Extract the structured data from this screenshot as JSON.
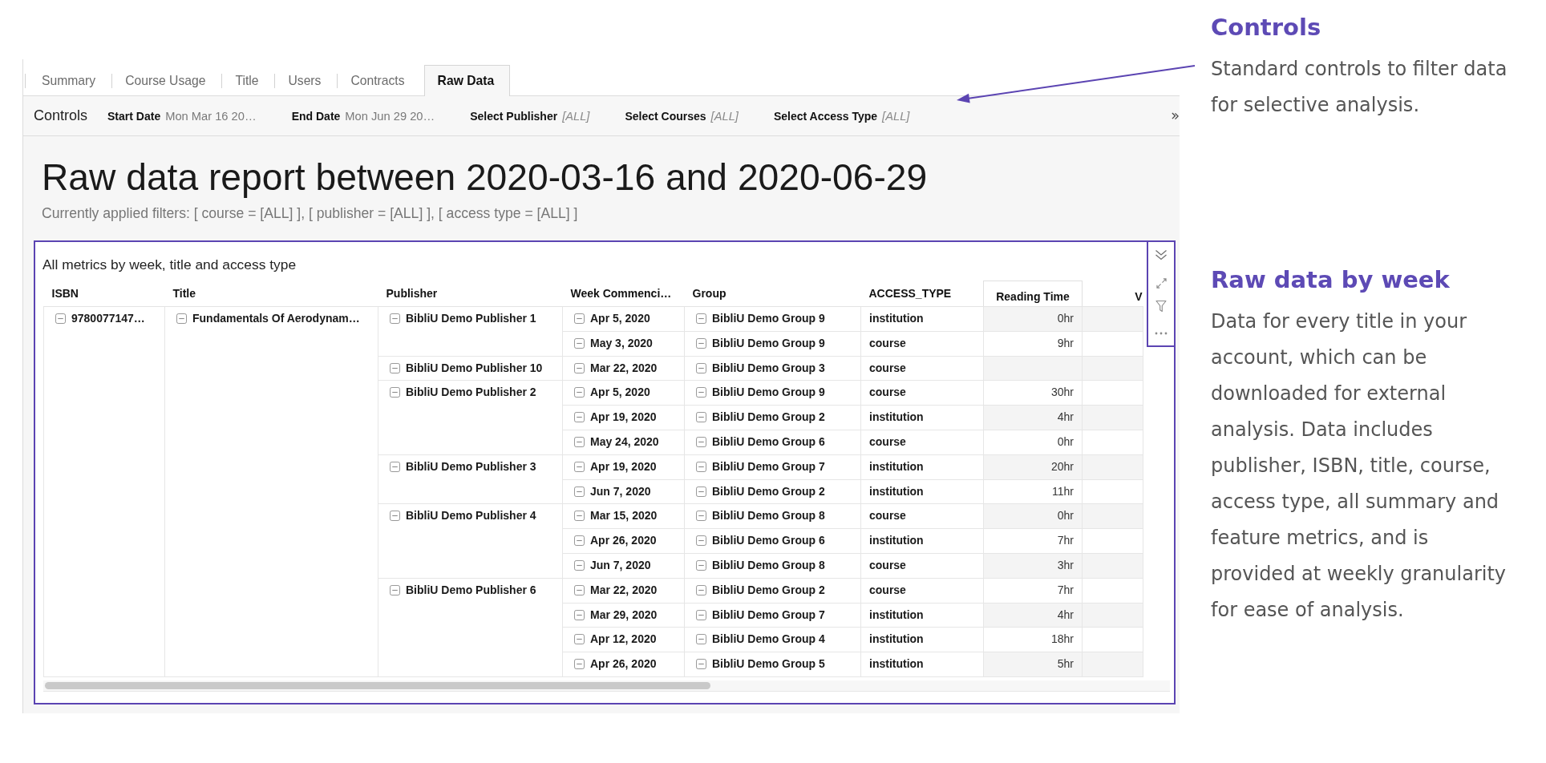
{
  "tabs": [
    {
      "label": "Summary",
      "selected": false
    },
    {
      "label": "Course Usage",
      "selected": false
    },
    {
      "label": "Title",
      "selected": false
    },
    {
      "label": "Users",
      "selected": false
    },
    {
      "label": "Contracts",
      "selected": false
    },
    {
      "label": "Raw Data",
      "selected": true
    }
  ],
  "controls": {
    "title": "Controls",
    "filters": [
      {
        "label": "Start Date",
        "value": "Mon Mar 16 20…",
        "kind": "date"
      },
      {
        "label": "End Date",
        "value": "Mon Jun 29 20…",
        "kind": "date"
      },
      {
        "label": "Select Publisher",
        "value": "[ALL]",
        "kind": "select"
      },
      {
        "label": "Select Courses",
        "value": "[ALL]",
        "kind": "select"
      },
      {
        "label": "Select Access Type",
        "value": "[ALL]",
        "kind": "select"
      }
    ]
  },
  "report": {
    "title": "Raw data report between 2020-03-16 and 2020-06-29",
    "applied_filters": "Currently applied filters: [ course = [ALL] ], [ publisher = [ALL] ], [ access type = [ALL] ]"
  },
  "visual": {
    "title": "All metrics by week, title and access type",
    "table": {
      "columns": [
        "ISBN",
        "Title",
        "Publisher",
        "Week Commenci…",
        "Group",
        "ACCESS_TYPE",
        "Reading Time",
        "V"
      ],
      "isbn": {
        "text": "9780077147…",
        "expanded": true
      },
      "title": {
        "text": "Fundamentals Of Aerodynam…",
        "expanded": true
      },
      "publishers": [
        {
          "name": "BibliU Demo Publisher 1",
          "expanded": true,
          "rows": [
            {
              "week": "Apr 5, 2020",
              "week_expanded": true,
              "group": "BibliU Demo Group 9",
              "group_expanded": true,
              "access_type": "institution",
              "reading_time": "0hr"
            },
            {
              "week": "May 3, 2020",
              "week_expanded": true,
              "group": "BibliU Demo Group 9",
              "group_expanded": true,
              "access_type": "course",
              "reading_time": "9hr"
            }
          ]
        },
        {
          "name": "BibliU Demo Publisher 10",
          "expanded": true,
          "rows": [
            {
              "week": "Mar 22, 2020",
              "week_expanded": true,
              "group": "BibliU Demo Group 3",
              "group_expanded": true,
              "access_type": "course"
            }
          ]
        },
        {
          "name": "BibliU Demo Publisher 2",
          "expanded": true,
          "rows": [
            {
              "week": "Apr 5, 2020",
              "week_expanded": true,
              "group": "BibliU Demo Group 9",
              "group_expanded": true,
              "access_type": "course",
              "reading_time": "30hr"
            },
            {
              "week": "Apr 19, 2020",
              "week_expanded": true,
              "group": "BibliU Demo Group 2",
              "group_expanded": true,
              "access_type": "institution",
              "reading_time": "4hr"
            },
            {
              "week": "May 24, 2020",
              "week_expanded": true,
              "group": "BibliU Demo Group 6",
              "group_expanded": true,
              "access_type": "course",
              "reading_time": "0hr"
            }
          ]
        },
        {
          "name": "BibliU Demo Publisher 3",
          "expanded": true,
          "rows": [
            {
              "week": "Apr 19, 2020",
              "week_expanded": true,
              "group": "BibliU Demo Group 7",
              "group_expanded": true,
              "access_type": "institution",
              "reading_time": "20hr"
            },
            {
              "week": "Jun 7, 2020",
              "week_expanded": true,
              "group": "BibliU Demo Group 2",
              "group_expanded": true,
              "access_type": "institution",
              "reading_time": "11hr"
            }
          ]
        },
        {
          "name": "BibliU Demo Publisher 4",
          "expanded": true,
          "rows": [
            {
              "week": "Mar 15, 2020",
              "week_expanded": true,
              "group": "BibliU Demo Group 8",
              "group_expanded": true,
              "access_type": "course",
              "reading_time": "0hr"
            },
            {
              "week": "Apr 26, 2020",
              "week_expanded": true,
              "group": "BibliU Demo Group 6",
              "group_expanded": true,
              "access_type": "institution",
              "reading_time": "7hr"
            },
            {
              "week": "Jun 7, 2020",
              "week_expanded": true,
              "group": "BibliU Demo Group 8",
              "group_expanded": true,
              "access_type": "course",
              "reading_time": "3hr"
            }
          ]
        },
        {
          "name": "BibliU Demo Publisher 6",
          "expanded": true,
          "rows": [
            {
              "week": "Mar 22, 2020",
              "week_expanded": true,
              "group": "BibliU Demo Group 2",
              "group_expanded": true,
              "access_type": "course",
              "reading_time": "7hr"
            },
            {
              "week": "Mar 29, 2020",
              "week_expanded": true,
              "group": "BibliU Demo Group 7",
              "group_expanded": true,
              "access_type": "institution",
              "reading_time": "4hr"
            },
            {
              "week": "Apr 12, 2020",
              "week_expanded": true,
              "group": "BibliU Demo Group 4",
              "group_expanded": true,
              "access_type": "institution",
              "reading_time": "18hr"
            },
            {
              "week": "Apr 26, 2020",
              "week_expanded": true,
              "group": "BibliU Demo Group 5",
              "group_expanded": true,
              "access_type": "institution",
              "reading_time": "5hr"
            }
          ]
        }
      ]
    }
  },
  "annotations": [
    {
      "heading": "Controls",
      "text": "Standard controls to filter data\nfor selective analysis."
    },
    {
      "heading": "Raw data by week",
      "text": "Data for every title in your\naccount, which can be\ndownloaded for external\nanalysis. Data includes\npublisher, ISBN, title, course,\naccess type, all summary and\nfeature metrics, and is\nprovided at weekly granularity\nfor ease of analysis."
    }
  ]
}
